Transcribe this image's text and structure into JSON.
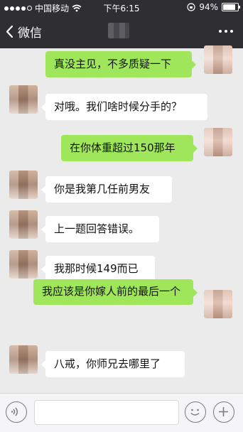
{
  "status_bar": {
    "carrier": "中国移动",
    "time": "下午6:15",
    "battery_percent": "94%",
    "battery_level": 0.94
  },
  "nav": {
    "back_label": "微信"
  },
  "messages": [
    {
      "side": "right",
      "text": "真没主见，不多质疑一下"
    },
    {
      "side": "left",
      "text": "对哦。我们啥时候分手的？"
    },
    {
      "side": "right",
      "text": "在你体重超过150那年"
    },
    {
      "side": "left",
      "text": "你是我第几任前男友"
    },
    {
      "side": "left",
      "text": "上一题回答错误。"
    },
    {
      "side": "left",
      "text": "我那时候149而已"
    },
    {
      "side": "right",
      "text": "我应该是你嫁人前的最后一个"
    },
    {
      "side": "left",
      "text": "八戒，你师兄去哪里了"
    }
  ],
  "colors": {
    "header": "#2e2e33",
    "chat_background": "#ebebeb",
    "my_bubble": "#9fe65a",
    "other_bubble": "#ffffff"
  },
  "icons": [
    "back-chevron-icon",
    "more-icon",
    "voice-icon",
    "emoji-icon",
    "plus-icon",
    "wifi-icon",
    "battery-icon",
    "lock-rotation-icon"
  ]
}
